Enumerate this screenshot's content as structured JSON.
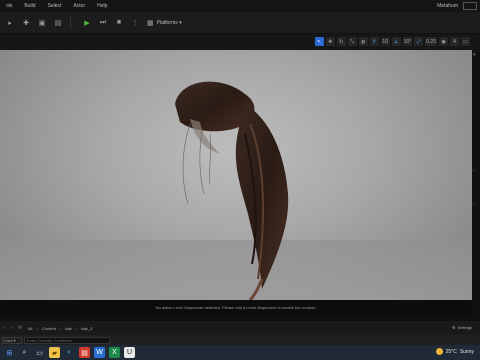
{
  "menu": {
    "items": [
      "ols",
      "Build",
      "Select",
      "Actor",
      "Help"
    ],
    "project_title": "Metahum"
  },
  "toolbar": {
    "platforms_label": "Platforms"
  },
  "viewport_toolbar": {
    "grid_value": "10",
    "rotation_value": "10°",
    "scale_value": "0.25",
    "camera_speed": "4"
  },
  "viewport": {
    "notice": "No active Level Sequencer detected. Please edit a Level Sequencer to enable full controls."
  },
  "content_browser": {
    "breadcrumb": [
      "All",
      "Content",
      "hair",
      "hair_3"
    ],
    "settings_label": "Settings"
  },
  "status": {
    "cmd_label": "Cmd",
    "console_placeholder": "Enter Console Command"
  },
  "taskbar": {
    "temperature": "25°C",
    "weather": "Sunny"
  },
  "colors": {
    "accent_blue": "#2a6ad2",
    "play_green": "#4fbf3a",
    "taskbar": "#202a36"
  }
}
